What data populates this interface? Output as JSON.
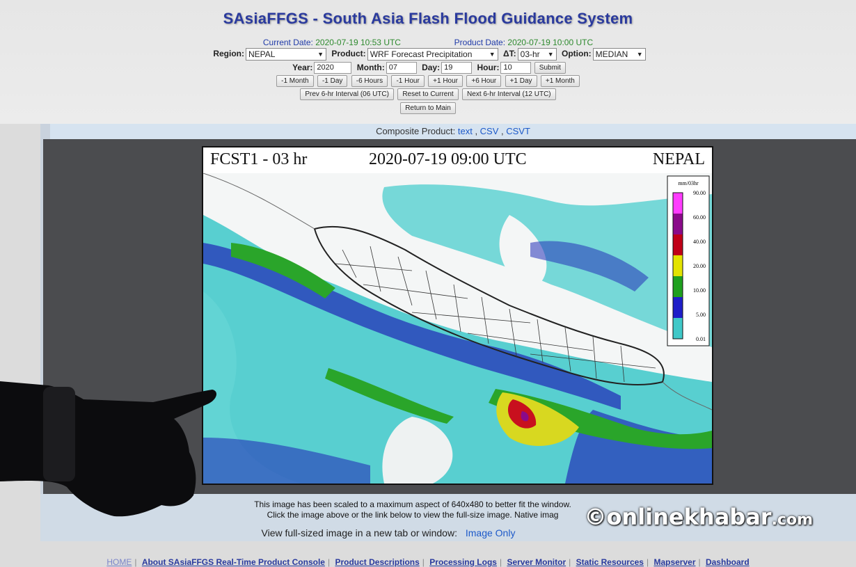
{
  "header": {
    "title": "SAsiaFFGS - South Asia Flash Flood Guidance System",
    "current_date_label": "Current Date:",
    "current_date": "2020-07-19 10:53 UTC",
    "product_date_label": "Product Date:",
    "product_date": "2020-07-19 10:00 UTC"
  },
  "controls": {
    "region_label": "Region:",
    "region_value": "NEPAL",
    "product_label": "Product:",
    "product_value": "WRF Forecast Precipitation",
    "dt_label": "ΔT:",
    "dt_value": "03-hr",
    "option_label": "Option:",
    "option_value": "MEDIAN",
    "year_label": "Year:",
    "year_value": "2020",
    "month_label": "Month:",
    "month_value": "07",
    "day_label": "Day:",
    "day_value": "19",
    "hour_label": "Hour:",
    "hour_value": "10",
    "submit": "Submit",
    "steps": [
      "-1 Month",
      "-1 Day",
      "-6 Hours",
      "-1 Hour",
      "+1 Hour",
      "+6 Hour",
      "+1 Day",
      "+1 Month"
    ],
    "prev_interval": "Prev 6-hr Interval (06 UTC)",
    "reset": "Reset to Current",
    "next_interval": "Next 6-hr Interval (12 UTC)",
    "return_main": "Return to Main"
  },
  "composite": {
    "label": "Composite Product:",
    "text_link": "text",
    "csv_link": "CSV",
    "csvt_link": "CSVT"
  },
  "map": {
    "title_left": "FCST1 - 03 hr",
    "title_center": "2020-07-19 09:00 UTC",
    "title_right": "NEPAL",
    "legend_unit": "mm/03hr",
    "legend_ticks": [
      "90.00",
      "60.00",
      "40.00",
      "20.00",
      "10.00",
      "5.00",
      "0.01"
    ],
    "legend_colors": [
      "#ff3cff",
      "#8a0a8a",
      "#c00018",
      "#e3e300",
      "#1ea01e",
      "#1e1ec8",
      "#40c8c8"
    ]
  },
  "notes": {
    "line1": "This image has been scaled to a maximum aspect of 640x480 to better fit the window.",
    "line2": "Click the image above or the link below to view the full-size image. Native imag",
    "fullsize_label": "View full-sized image in a new tab or window:",
    "image_only": "Image Only"
  },
  "bottom_nav": [
    "HOME",
    "About SAsiaFFGS Real-Time Product Console",
    "Product Descriptions",
    "Processing Logs",
    "Server Monitor",
    "Static Resources",
    "Mapserver",
    "Dashboard"
  ],
  "watermark": {
    "symbol": "©",
    "brand": "onlinekhabar",
    "suffix": ".com"
  }
}
